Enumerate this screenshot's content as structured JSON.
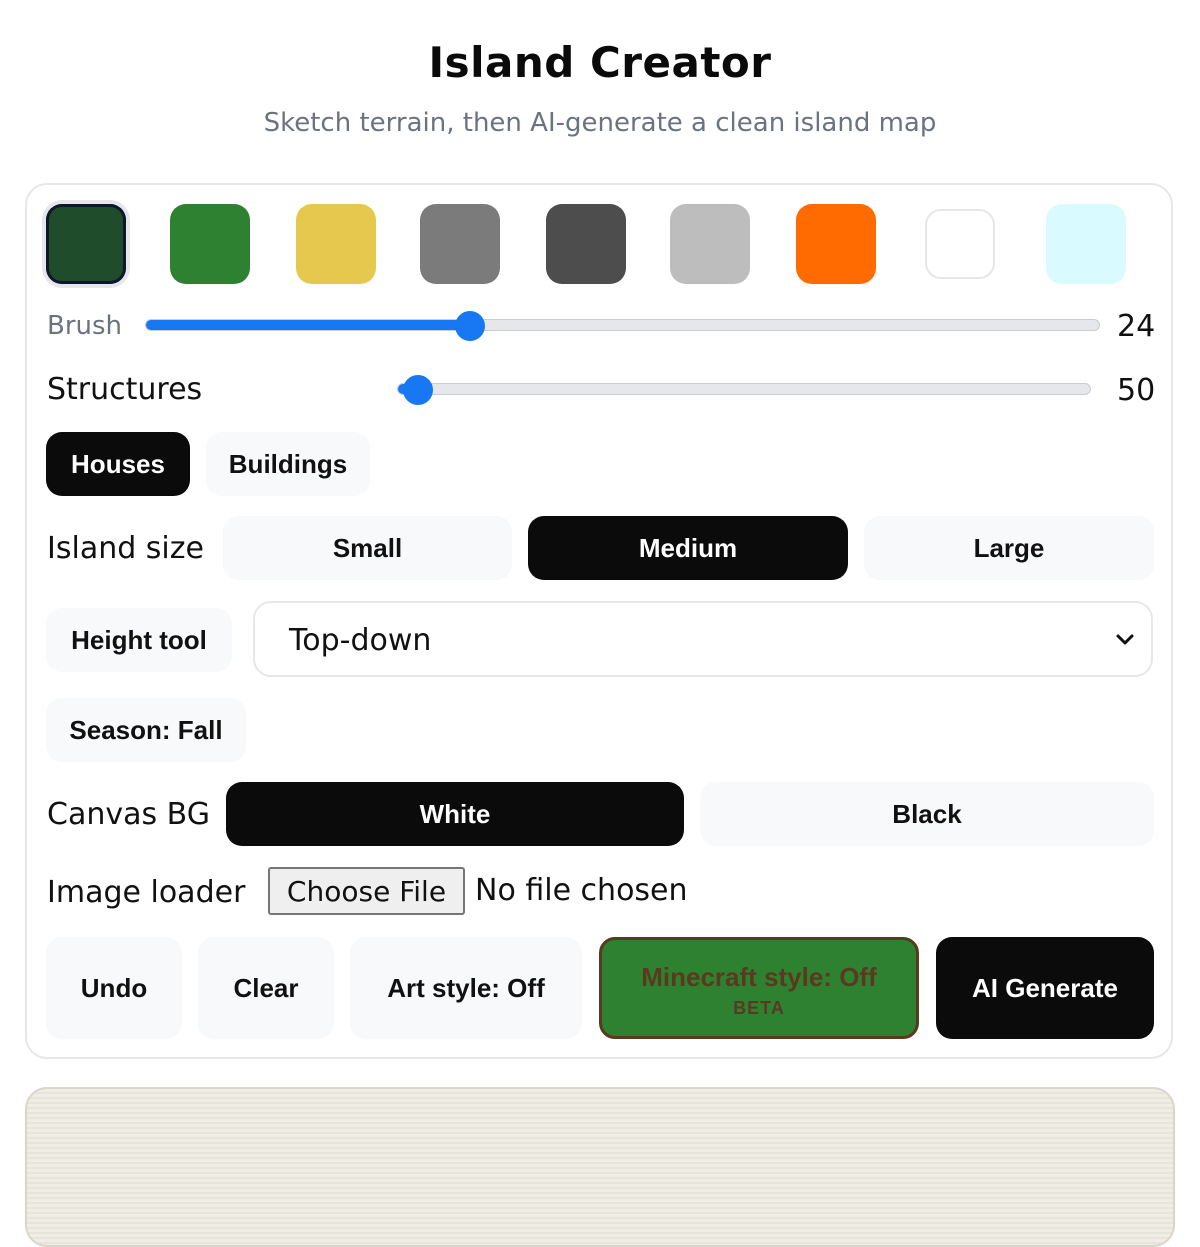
{
  "header": {
    "title": "Island Creator",
    "subtitle": "Sketch terrain, then AI-generate a clean island map"
  },
  "palette": {
    "colors": [
      "#1f4d2c",
      "#2f8132",
      "#e6c84f",
      "#7b7b7b",
      "#4d4d4d",
      "#bdbdbd",
      "#ff6b00",
      "#ffffff",
      "#d9fbff"
    ],
    "selected_index": 0
  },
  "brush": {
    "label": "Brush",
    "value": "24",
    "fraction": 0.34
  },
  "structures": {
    "label": "Structures",
    "value": "50",
    "fraction": 0.03,
    "types": [
      "Houses",
      "Buildings"
    ],
    "selected_type": "Houses"
  },
  "island_size": {
    "label": "Island size",
    "options": [
      "Small",
      "Medium",
      "Large"
    ],
    "selected": "Medium"
  },
  "height_tool": {
    "label": "Height tool",
    "view_value": "Top-down"
  },
  "season": {
    "label": "Season: Fall"
  },
  "canvas_bg": {
    "label": "Canvas BG",
    "options": [
      "White",
      "Black"
    ],
    "selected": "White"
  },
  "image_loader": {
    "label": "Image loader",
    "button": "Choose File",
    "status": "No file chosen"
  },
  "actions": {
    "undo": "Undo",
    "clear": "Clear",
    "art_style": "Art style: Off",
    "minecraft_style": "Minecraft style: Off",
    "minecraft_badge": "BETA",
    "generate": "AI Generate"
  },
  "icons": {
    "select_chevron": "chevron-down-icon"
  }
}
